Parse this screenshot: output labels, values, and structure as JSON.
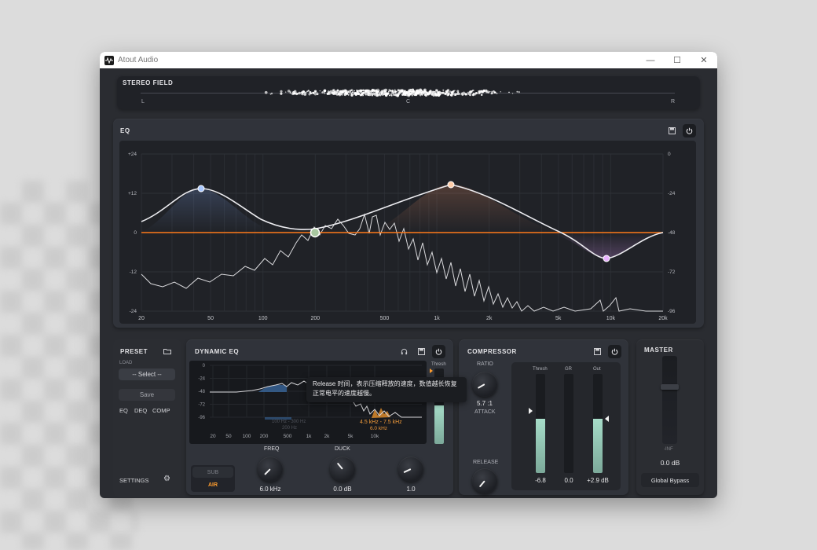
{
  "window": {
    "title": "Atout Audio"
  },
  "stereo": {
    "title": "STEREO FIELD",
    "left": "L",
    "center": "C",
    "right": "R"
  },
  "eq": {
    "title": "EQ",
    "y_left": [
      "+24",
      "+12",
      "0",
      "-12",
      "-24"
    ],
    "y_right": [
      "0",
      "-24",
      "-48",
      "-72",
      "-96"
    ],
    "x_labels": [
      "20",
      "50",
      "100",
      "200",
      "500",
      "1k",
      "2k",
      "5k",
      "10k",
      "20k"
    ]
  },
  "preset": {
    "title": "PRESET",
    "load_label": "LOAD",
    "select_value": "-- Select --",
    "save_label": "Save",
    "tabs": [
      "EQ",
      "DEQ",
      "COMP"
    ],
    "settings_label": "SETTINGS"
  },
  "deq": {
    "title": "DYNAMIC EQ",
    "y_labels": [
      "0",
      "-24",
      "-48",
      "-72",
      "-96"
    ],
    "x_labels": [
      "20",
      "50",
      "100",
      "200",
      "500",
      "1k",
      "2k",
      "5k",
      "10k"
    ],
    "thresh_label": "Thresh",
    "band1_range": "100 Hz - 300 Hz",
    "band1_center": "200 Hz",
    "band2_range": "4.5 kHz - 7.5 kHz",
    "band2_center": "6.0 kHz",
    "sub_label": "SUB",
    "air_label": "AIR",
    "freq_label": "FREQ",
    "freq_value": "6.0 kHz",
    "duck_label": "DUCK",
    "duck_value": "0.0 dB",
    "third_value": "1.0"
  },
  "comp": {
    "title": "COMPRESSOR",
    "ratio_label": "RATIO",
    "ratio_value": "5.7 :1",
    "attack_label": "ATTACK",
    "release_label": "RELEASE",
    "meters": [
      {
        "label": "Thresh",
        "value": "-6.8",
        "level": 0.55
      },
      {
        "label": "GR",
        "value": "0.0",
        "level": 0.0
      },
      {
        "label": "Out",
        "value": "+2.9 dB",
        "level": 0.55
      }
    ]
  },
  "master": {
    "title": "MASTER",
    "fader_floor": "-INF",
    "value": "0.0 dB",
    "bypass_label": "Global Bypass"
  },
  "tooltip": {
    "line1": "Release 时间，表示压缩释放的速度，数值越长恢复",
    "line2": "正常电平的速度越慢。"
  },
  "colors": {
    "accent_orange": "#ff7a1a",
    "node_blue": "#a9c8ff",
    "node_peach": "#ffcda8",
    "node_pink": "#e9b2ff",
    "meter_green": "#9fd6c1"
  }
}
